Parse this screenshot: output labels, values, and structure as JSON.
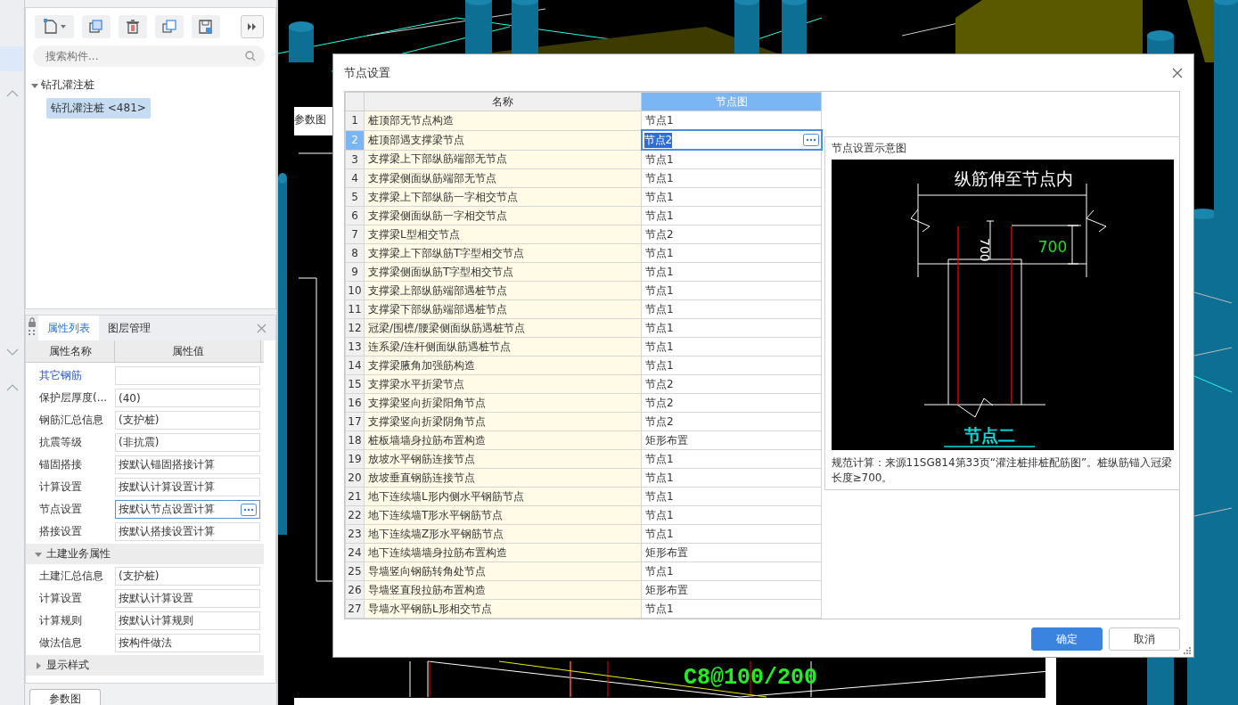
{
  "component_panel": {
    "search": {
      "placeholder": "搜索构件..."
    },
    "tree": [
      {
        "label": "钻孔灌注桩",
        "expanded": true,
        "children": [
          {
            "label": "钻孔灌注桩 <481>",
            "selected": true
          }
        ]
      }
    ]
  },
  "property_panel": {
    "tabs": [
      {
        "label": "属性列表",
        "selected": true
      },
      {
        "label": "图层管理",
        "selected": false
      }
    ],
    "columns": [
      "属性名称",
      "属性值"
    ],
    "rows": [
      {
        "kind": "link",
        "name": "其它钢筋",
        "value": ""
      },
      {
        "kind": "property",
        "name": "保护层厚度(...",
        "value": "(40)"
      },
      {
        "kind": "property",
        "name": "钢筋汇总信息",
        "value": "(支护桩)"
      },
      {
        "kind": "property",
        "name": "抗震等级",
        "value": "(非抗震)"
      },
      {
        "kind": "property",
        "name": "锚固搭接",
        "value": "按默认锚固搭接计算"
      },
      {
        "kind": "property",
        "name": "计算设置",
        "value": "按默认计算设置计算"
      },
      {
        "kind": "picker",
        "name": "节点设置",
        "value": "按默认节点设置计算"
      },
      {
        "kind": "property",
        "name": "搭接设置",
        "value": "按默认搭接设置计算"
      },
      {
        "kind": "group",
        "name": "土建业务属性",
        "expanded": true
      },
      {
        "kind": "property",
        "name": "土建汇总信息",
        "value": "(支护桩)"
      },
      {
        "kind": "property",
        "name": "计算设置",
        "value": "按默认计算设置"
      },
      {
        "kind": "property",
        "name": "计算规则",
        "value": "按默认计算规则"
      },
      {
        "kind": "property",
        "name": "做法信息",
        "value": "按构件做法"
      },
      {
        "kind": "group",
        "name": "显示样式",
        "expanded": false
      }
    ]
  },
  "param_button": "参数图",
  "viewport": {
    "panel_title": "参数图",
    "annotation": "C8@100/200"
  },
  "dialog": {
    "title": "节点设置",
    "table": {
      "columns": [
        {
          "label": "名称",
          "selected": false
        },
        {
          "label": "节点图",
          "selected": true
        }
      ],
      "rows": [
        {
          "number": "1",
          "name": "桩顶部无节点构造",
          "value": "节点1",
          "selected": false
        },
        {
          "number": "2",
          "name": "桩顶部遇支撑梁节点",
          "value": "节点2",
          "selected": true
        },
        {
          "number": "3",
          "name": "支撑梁上下部纵筋端部无节点",
          "value": "节点1",
          "selected": false
        },
        {
          "number": "4",
          "name": "支撑梁侧面纵筋端部无节点",
          "value": "节点1",
          "selected": false
        },
        {
          "number": "5",
          "name": "支撑梁上下部纵筋一字相交节点",
          "value": "节点1",
          "selected": false
        },
        {
          "number": "6",
          "name": "支撑梁侧面纵筋一字相交节点",
          "value": "节点1",
          "selected": false
        },
        {
          "number": "7",
          "name": "支撑梁L型相交节点",
          "value": "节点2",
          "selected": false
        },
        {
          "number": "8",
          "name": "支撑梁上下部纵筋T字型相交节点",
          "value": "节点1",
          "selected": false
        },
        {
          "number": "9",
          "name": "支撑梁侧面纵筋T字型相交节点",
          "value": "节点1",
          "selected": false
        },
        {
          "number": "10",
          "name": "支撑梁上部纵筋端部遇桩节点",
          "value": "节点1",
          "selected": false
        },
        {
          "number": "11",
          "name": "支撑梁下部纵筋端部遇桩节点",
          "value": "节点1",
          "selected": false
        },
        {
          "number": "12",
          "name": "冠梁/围檩/腰梁侧面纵筋遇桩节点",
          "value": "节点1",
          "selected": false
        },
        {
          "number": "13",
          "name": "连系梁/连杆侧面纵筋遇桩节点",
          "value": "节点1",
          "selected": false
        },
        {
          "number": "14",
          "name": "支撑梁腋角加强筋构造",
          "value": "节点1",
          "selected": false
        },
        {
          "number": "15",
          "name": "支撑梁水平折梁节点",
          "value": "节点2",
          "selected": false
        },
        {
          "number": "16",
          "name": "支撑梁竖向折梁阳角节点",
          "value": "节点2",
          "selected": false
        },
        {
          "number": "17",
          "name": "支撑梁竖向折梁阴角节点",
          "value": "节点2",
          "selected": false
        },
        {
          "number": "18",
          "name": "桩板墙墙身拉筋布置构造",
          "value": "矩形布置",
          "selected": false
        },
        {
          "number": "19",
          "name": "放坡水平钢筋连接节点",
          "value": "节点1",
          "selected": false
        },
        {
          "number": "20",
          "name": "放坡垂直钢筋连接节点",
          "value": "节点1",
          "selected": false
        },
        {
          "number": "21",
          "name": "地下连续墙L形内侧水平钢筋节点",
          "value": "节点1",
          "selected": false
        },
        {
          "number": "22",
          "name": "地下连续墙T形水平钢筋节点",
          "value": "节点1",
          "selected": false
        },
        {
          "number": "23",
          "name": "地下连续墙Z形水平钢筋节点",
          "value": "节点1",
          "selected": false
        },
        {
          "number": "24",
          "name": "地下连续墙墙身拉筋布置构造",
          "value": "矩形布置",
          "selected": false
        },
        {
          "number": "25",
          "name": "导墙竖向钢筋转角处节点",
          "value": "节点1",
          "selected": false
        },
        {
          "number": "26",
          "name": "导墙竖直段拉筋布置构造",
          "value": "矩形布置",
          "selected": false
        },
        {
          "number": "27",
          "name": "导墙水平钢筋L形相交节点",
          "value": "节点1",
          "selected": false
        }
      ]
    },
    "preview": {
      "title": "节点设置示意图",
      "heading": "纵筋伸至节点内",
      "dimension": "700",
      "dimension_vertical": "700",
      "caption": "节点二",
      "note": "规范计算：来源11SG814第33页“灌注桩排桩配筋图”。桩纵筋锚入冠梁长度≥700。"
    },
    "buttons": [
      {
        "label": "确定",
        "primary": true
      },
      {
        "label": "取消",
        "primary": false
      }
    ]
  }
}
